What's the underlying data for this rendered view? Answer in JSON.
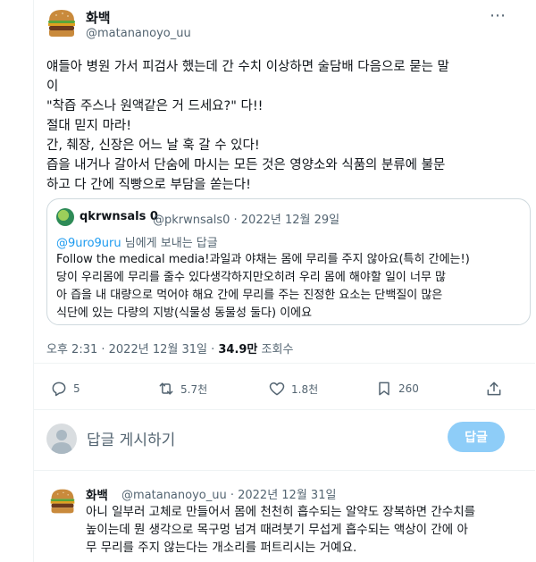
{
  "tweet": {
    "author_name": "화백",
    "author_handle": "@matananoyo_uu",
    "more_icon": "⋯",
    "lines": [
      "얘들아 병원 가서 피검사 했는데 간 수치 이상하면 술담배 다음으로 묻는 말",
      "이",
      "\"착즙 주스나 원액같은 거 드세요?\" 다!!",
      "절대 믿지 마라!",
      "간, 췌장, 신장은 어느 날 훅 갈 수 있다!",
      "즙을 내거나 갈아서 단숨에 마시는 모든 것은 영양소와 식품의 분류에 불문",
      "하고 다 간에 직빵으로 부담을 쏟는다!"
    ],
    "quote": {
      "name": "qkrwnsals 0",
      "meta": "@pkrwnsals0 · 2022년 12월 29일",
      "reply_mention": "@9uro9uru",
      "reply_suffix": " 님에게 보내는 답글",
      "lines": [
        "Follow the medical media!과일과 야채는 몸에 무리를 주지 않아요(특히 간에는!)",
        "당이 우리몸에 무리를 줄수 있다생각하지만오히려 우리 몸에 해야할 일이 너무 많",
        "아 즙을 내 대량으로 먹어야 해요 간에 무리를 주는 진정한 요소는 단백질이 많은",
        "식단에 있는 다량의 지방(식물성 동물성 둘다) 이에요"
      ]
    },
    "timestamp": "오후 2:31 · 2022년 12월 31일 · ",
    "views_count": "34.9만",
    "views_label": " 조회수",
    "actions": {
      "replies": "5",
      "retweets": "5.7천",
      "likes": "1.8천",
      "bookmarks": "260"
    }
  },
  "composer": {
    "placeholder": "답글 게시하기",
    "button_label": "답글"
  },
  "reply": {
    "author_name": "화백",
    "meta": "@matananoyo_uu · 2022년 12월 31일",
    "lines": [
      "아니 일부러 고체로 만들어서 몸에 천천히 흡수되는 알약도 장복하면 간수치를",
      "높이는데 뭔 생각으로 목구멍 넘겨 때려붓기 무섭게 흡수되는 액상이 간에 아",
      "무 무리를 주지 않는다는 개소리를 퍼트리시는 거예요."
    ]
  },
  "colors": {
    "text": "#0f1419",
    "muted": "#536471",
    "link": "#1d9bf0",
    "button_disabled": "#8ecdf8",
    "border": "#cfd9de"
  }
}
